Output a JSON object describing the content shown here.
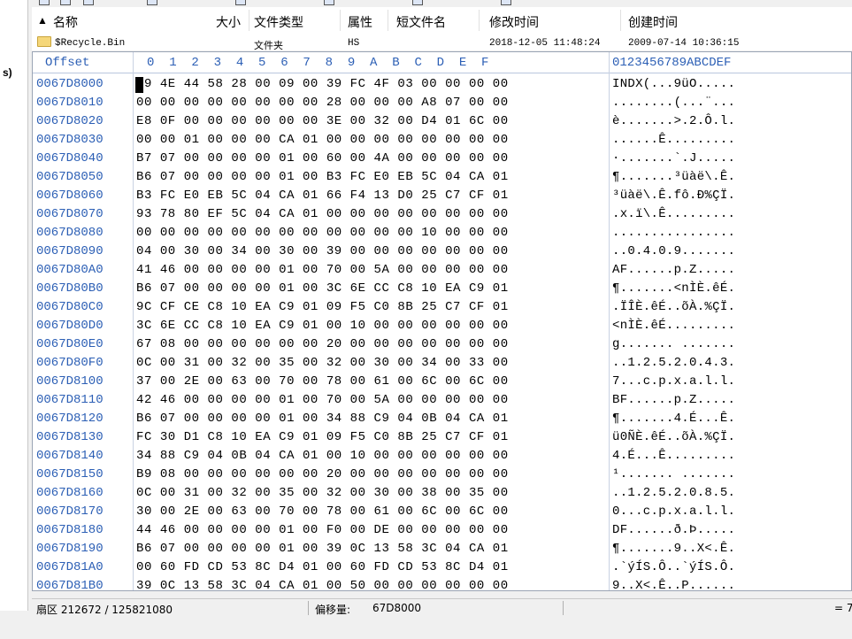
{
  "sidebar": {
    "label": "s)"
  },
  "file_list": {
    "columns": [
      "名称",
      "大小",
      "文件类型",
      "属性",
      "短文件名",
      "修改时间",
      "创建时间"
    ],
    "rows": [
      {
        "name": "$Recycle.Bin",
        "size": "",
        "type": "文件夹",
        "attr": "HS",
        "short": "",
        "modified": "2018-12-05 11:48:24",
        "created": "2009-07-14 10:36:15"
      }
    ]
  },
  "hex": {
    "header_offset": "Offset",
    "header_bytes": "0  1  2  3  4  5  6  7  8  9  A  B  C  D  E  F",
    "header_ascii": "0123456789ABCDEF",
    "rows": [
      {
        "offset": "0067D8000",
        "bytes": "49 4E 44 58 28 00 09 00 39 FC 4F 03 00 00 00 00",
        "ascii": "INDX(...9üO....."
      },
      {
        "offset": "0067D8010",
        "bytes": "00 00 00 00 00 00 00 00 28 00 00 00 A8 07 00 00",
        "ascii": "........(...¨..."
      },
      {
        "offset": "0067D8020",
        "bytes": "E8 0F 00 00 00 00 00 00 3E 00 32 00 D4 01 6C 00",
        "ascii": "è.......>.2.Ô.l."
      },
      {
        "offset": "0067D8030",
        "bytes": "00 00 01 00 00 00 CA 01 00 00 00 00 00 00 00 00",
        "ascii": "......Ê........."
      },
      {
        "offset": "0067D8040",
        "bytes": "B7 07 00 00 00 00 01 00 60 00 4A 00 00 00 00 00",
        "ascii": "·.......`.J....."
      },
      {
        "offset": "0067D8050",
        "bytes": "B6 07 00 00 00 00 01 00 B3 FC E0 EB 5C 04 CA 01",
        "ascii": "¶.......³üàë\\.Ê."
      },
      {
        "offset": "0067D8060",
        "bytes": "B3 FC E0 EB 5C 04 CA 01 66 F4 13 D0 25 C7 CF 01",
        "ascii": "³üàë\\.Ê.fô.Ð%ÇÏ."
      },
      {
        "offset": "0067D8070",
        "bytes": "93 78 80 EF 5C 04 CA 01 00 00 00 00 00 00 00 00",
        "ascii": ".x.ï\\.Ê........."
      },
      {
        "offset": "0067D8080",
        "bytes": "00 00 00 00 00 00 00 00 00 00 00 00 10 00 00 00",
        "ascii": "................"
      },
      {
        "offset": "0067D8090",
        "bytes": "04 00 30 00 34 00 30 00 39 00 00 00 00 00 00 00",
        "ascii": "..0.4.0.9......."
      },
      {
        "offset": "0067D80A0",
        "bytes": "41 46 00 00 00 00 01 00 70 00 5A 00 00 00 00 00",
        "ascii": "AF......p.Z....."
      },
      {
        "offset": "0067D80B0",
        "bytes": "B6 07 00 00 00 00 01 00 3C 6E CC C8 10 EA C9 01",
        "ascii": "¶.......<nÌÈ.êÉ."
      },
      {
        "offset": "0067D80C0",
        "bytes": "9C CF CE C8 10 EA C9 01 09 F5 C0 8B 25 C7 CF 01",
        "ascii": ".ÏÎÈ.êÉ..õÀ.%ÇÏ."
      },
      {
        "offset": "0067D80D0",
        "bytes": "3C 6E CC C8 10 EA C9 01 00 10 00 00 00 00 00 00",
        "ascii": "<nÌÈ.êÉ........."
      },
      {
        "offset": "0067D80E0",
        "bytes": "67 08 00 00 00 00 00 00 20 00 00 00 00 00 00 00",
        "ascii": "g....... ......."
      },
      {
        "offset": "0067D80F0",
        "bytes": "0C 00 31 00 32 00 35 00 32 00 30 00 34 00 33 00",
        "ascii": "..1.2.5.2.0.4.3."
      },
      {
        "offset": "0067D8100",
        "bytes": "37 00 2E 00 63 00 70 00 78 00 61 00 6C 00 6C 00",
        "ascii": "7...c.p.x.a.l.l."
      },
      {
        "offset": "0067D8110",
        "bytes": "42 46 00 00 00 00 01 00 70 00 5A 00 00 00 00 00",
        "ascii": "BF......p.Z....."
      },
      {
        "offset": "0067D8120",
        "bytes": "B6 07 00 00 00 00 01 00 34 88 C9 04 0B 04 CA 01",
        "ascii": "¶.......4.É...Ê."
      },
      {
        "offset": "0067D8130",
        "bytes": "FC 30 D1 C8 10 EA C9 01 09 F5 C0 8B 25 C7 CF 01",
        "ascii": "ü0ÑÈ.êÉ..õÀ.%ÇÏ."
      },
      {
        "offset": "0067D8140",
        "bytes": "34 88 C9 04 0B 04 CA 01 00 10 00 00 00 00 00 00",
        "ascii": "4.É...Ê........."
      },
      {
        "offset": "0067D8150",
        "bytes": "B9 08 00 00 00 00 00 00 20 00 00 00 00 00 00 00",
        "ascii": "¹....... ......."
      },
      {
        "offset": "0067D8160",
        "bytes": "0C 00 31 00 32 00 35 00 32 00 30 00 38 00 35 00",
        "ascii": "..1.2.5.2.0.8.5."
      },
      {
        "offset": "0067D8170",
        "bytes": "30 00 2E 00 63 00 70 00 78 00 61 00 6C 00 6C 00",
        "ascii": "0...c.p.x.a.l.l."
      },
      {
        "offset": "0067D8180",
        "bytes": "44 46 00 00 00 00 01 00 F0 00 DE 00 00 00 00 00",
        "ascii": "DF......ð.Þ....."
      },
      {
        "offset": "0067D8190",
        "bytes": "B6 07 00 00 00 00 01 00 39 0C 13 58 3C 04 CA 01",
        "ascii": "¶.......9..X<.Ê."
      },
      {
        "offset": "0067D81A0",
        "bytes": "00 60 FD CD 53 8C D4 01 00 60 FD CD 53 8C D4 01",
        "ascii": ".`ýÍS.Ô..`ýÍS.Ô."
      },
      {
        "offset": "0067D81B0",
        "bytes": "39 0C 13 58 3C 04 CA 01 00 50 00 00 00 00 00 00",
        "ascii": "9..X<.Ê..P......"
      }
    ]
  },
  "status": {
    "sector": "扇区 212672 / 125821080",
    "offset_label": "偏移量:",
    "offset_value": "67D8000",
    "right": "= 7"
  },
  "colors": {
    "offset_blue": "#2c5fb5",
    "panel_border": "#9aa4b4"
  }
}
